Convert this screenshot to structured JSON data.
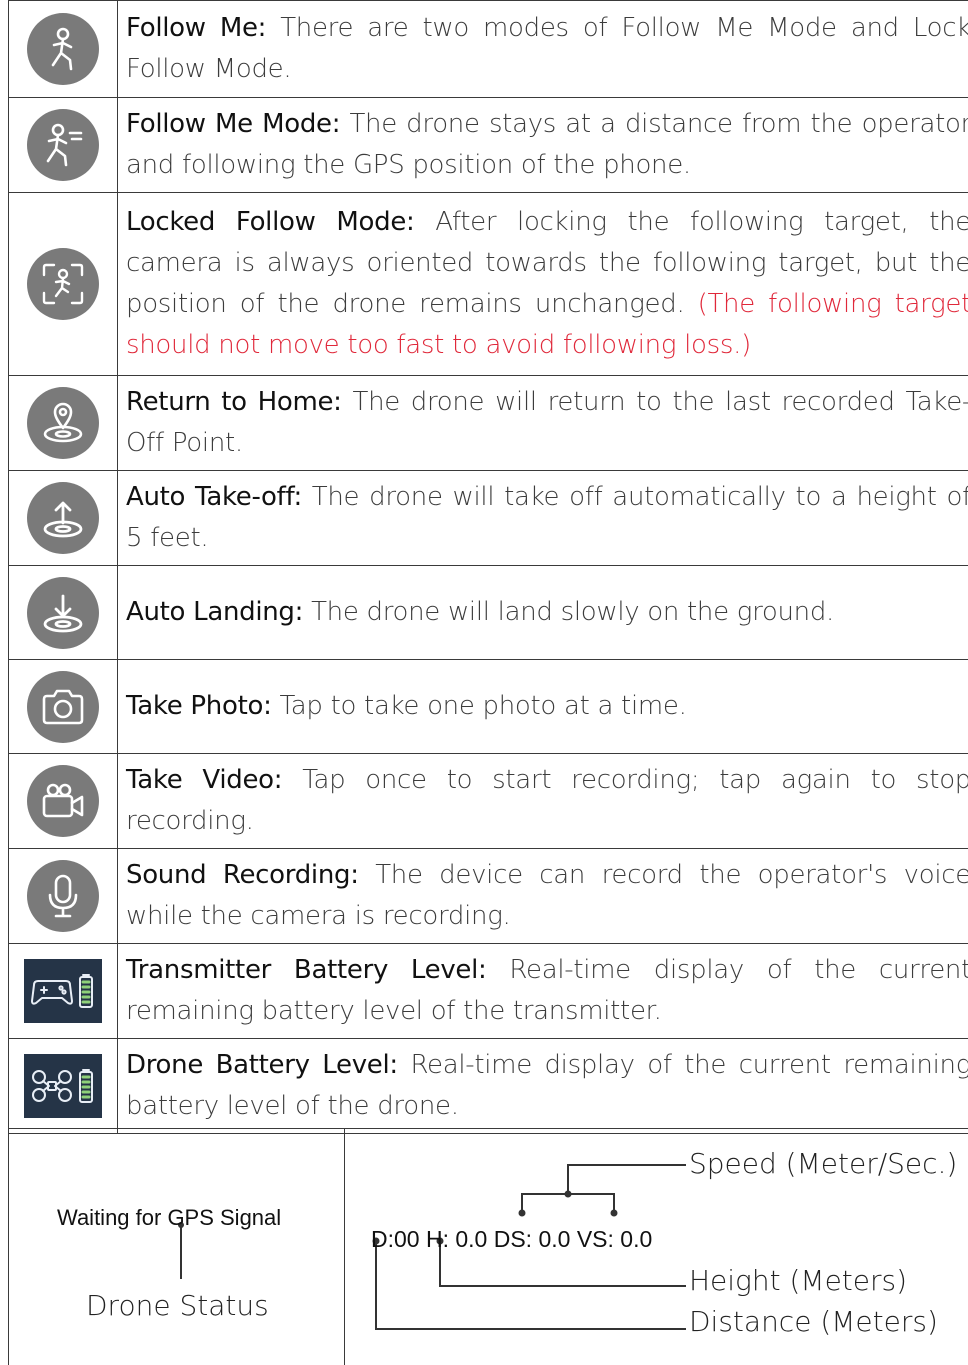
{
  "rows": [
    {
      "icon": "follow-me-icon",
      "term": "Follow Me:",
      "desc": "There are two modes of  Follow Me Mode and Lock Follow Mode.",
      "warning": ""
    },
    {
      "icon": "follow-me-mode-icon",
      "term": "Follow Me Mode:",
      "desc": "The drone stays at a distance from the operator and following the GPS position of the phone.",
      "warning": ""
    },
    {
      "icon": "locked-follow-icon",
      "term": "Locked Follow Mode:",
      "desc": "After locking the following target, the camera is always oriented towards the following target, but the position of the drone remains unchanged.",
      "warning": "(The following target should not move too fast to avoid following loss.)"
    },
    {
      "icon": "return-home-icon",
      "term": "Return to Home:",
      "desc": "The drone will return to the last recorded Take-Off Point.",
      "warning": ""
    },
    {
      "icon": "auto-takeoff-icon",
      "term": "Auto Take-off:",
      "desc": "The drone will take off automatically to a height of 5 feet.",
      "warning": ""
    },
    {
      "icon": "auto-landing-icon",
      "term": "Auto Landing:",
      "desc": "The drone will land slowly on the ground.",
      "warning": ""
    },
    {
      "icon": "camera-icon",
      "term": "Take Photo:",
      "desc": "Tap to take one photo at a time.",
      "warning": ""
    },
    {
      "icon": "video-camera-icon",
      "term": "Take Video:",
      "desc": "Tap once to start recording; tap again to stop recording.",
      "warning": ""
    },
    {
      "icon": "microphone-icon",
      "term": "Sound Recording:",
      "desc": "The device can record the operator's voice while the camera is recording.",
      "warning": ""
    },
    {
      "icon": "transmitter-battery-icon",
      "term": "Transmitter Battery Level:",
      "desc": "Real-time display of the current remaining battery level of the transmitter.",
      "warning": ""
    },
    {
      "icon": "drone-battery-icon",
      "term": "Drone Battery Level:",
      "desc": "Real-time display of the current remaining battery level of the drone.",
      "warning": ""
    }
  ],
  "status_panel": {
    "gps_text": "Waiting for GPS Signal",
    "drone_status_label": "Drone Status",
    "telemetry": "D:00 H: 0.0 DS: 0.0 VS: 0.0",
    "speed_label": "Speed (Meter/Sec.)",
    "height_label": "Height (Meters)",
    "distance_label": "Distance (Meters)"
  },
  "colors": {
    "warning": "#e0283a",
    "icon_circle": "#7a7a7a",
    "badge_bg": "#253447"
  }
}
